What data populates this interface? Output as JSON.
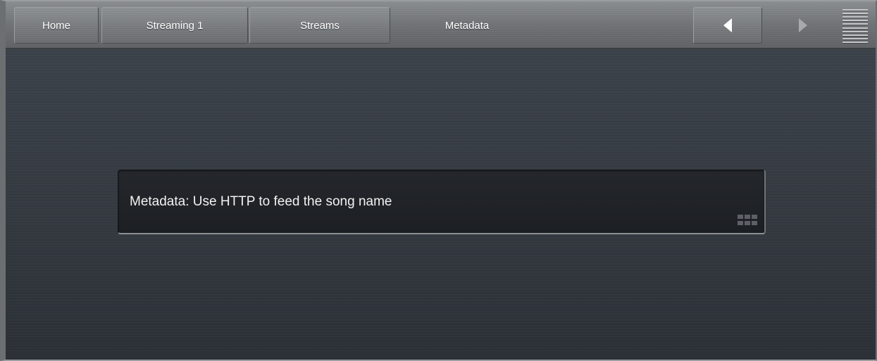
{
  "nav": {
    "home_label": "Home",
    "streaming_label": "Streaming 1",
    "streams_label": "Streams",
    "current_label": "Metadata",
    "back_icon": "chevron-left-icon",
    "forward_icon": "chevron-right-icon",
    "menu_icon": "menu-icon"
  },
  "main": {
    "info_text": "Metadata: Use HTTP to feed the song name",
    "grip_icon": "keypad-grip-icon"
  },
  "colors": {
    "background": "#2e333a",
    "topbar": "#76797c",
    "infobox": "#1f2226",
    "text": "#ffffff"
  }
}
